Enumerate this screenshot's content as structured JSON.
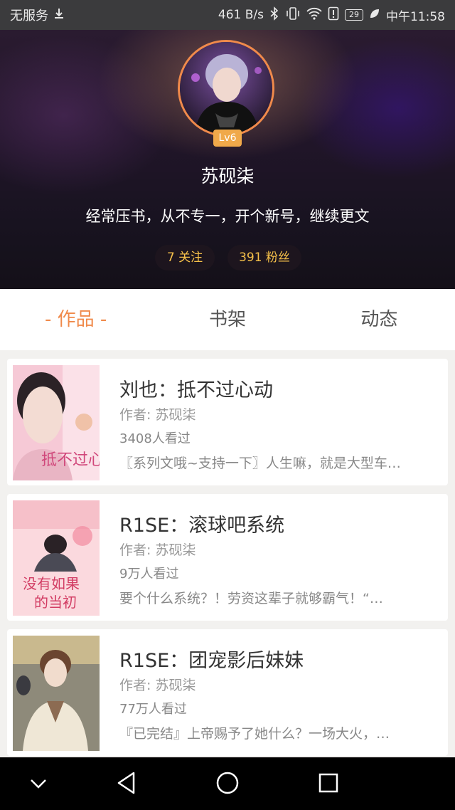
{
  "status_bar": {
    "carrier": "无服务",
    "speed": "461 B/s",
    "battery": "29",
    "time": "中午11:58"
  },
  "profile": {
    "level": "Lv6",
    "name": "苏砚柒",
    "bio": "经常压书，从不专一，开个新号，继续更文",
    "following": "7 关注",
    "fans": "391 粉丝"
  },
  "tabs": [
    {
      "label": "- 作品 -",
      "active": true
    },
    {
      "label": "书架",
      "active": false
    },
    {
      "label": "动态",
      "active": false
    }
  ],
  "books": [
    {
      "title": "刘也：抵不过心动",
      "author": "作者: 苏砚柒",
      "views": "3408人看过",
      "desc": "〖系列文哦~支持一下〗人生嘛，就是大型车…",
      "cover_text": "抵不过心动"
    },
    {
      "title": "R1SE：滚球吧系统",
      "author": "作者: 苏砚柒",
      "views": "9万人看过",
      "desc": "要个什么系统？！劳资这辈子就够霸气！“…",
      "cover_text_1": "没有如果",
      "cover_text_2": "的当初"
    },
    {
      "title": "R1SE：团宠影后妹妹",
      "author": "作者: 苏砚柒",
      "views": "77万人看过",
      "desc": "『已完结』上帝赐予了她什么？一场大火，…"
    }
  ],
  "icons": {
    "download": "download-icon",
    "bluetooth": "bluetooth-icon",
    "vibrate": "vibrate-icon",
    "wifi": "wifi-icon",
    "alert": "alert-icon",
    "leaf": "leaf-icon",
    "nav_down": "chevron-down-icon",
    "nav_back": "back-triangle-icon",
    "nav_home": "home-circle-icon",
    "nav_recent": "recent-square-icon"
  },
  "colors": {
    "accent": "#f08a4b",
    "badge": "#f0a94a",
    "stat_text": "#f5c04a"
  }
}
